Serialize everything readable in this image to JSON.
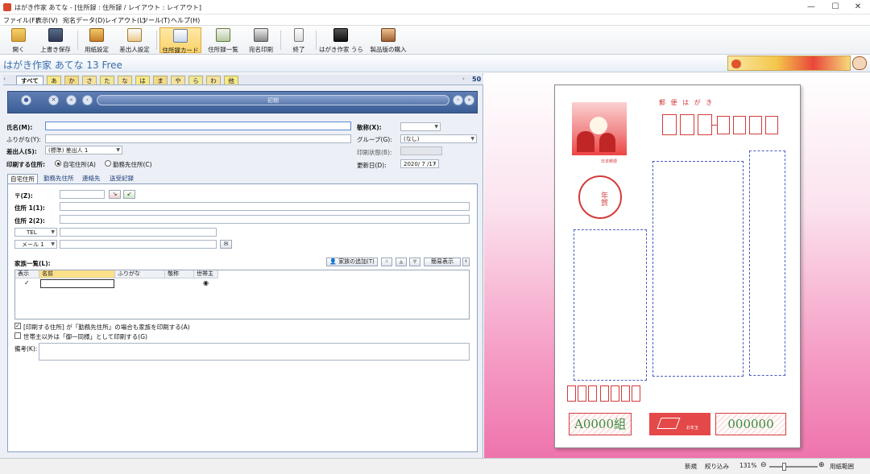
{
  "window": {
    "title": "はがき作家 あてな - [住所録 : 住所録 / レイアウト : レイアウト]",
    "minimize": "—",
    "maximize": "☐",
    "close": "✕"
  },
  "menu": [
    "ファイル(F)",
    "表示(V)",
    "宛名データ(D)",
    "レイアウト(L)",
    "ツール(T)",
    "ヘルプ(H)"
  ],
  "toolbar": {
    "items": [
      {
        "label": "開く",
        "icon": "folder-open-icon"
      },
      {
        "label": "上書き保存",
        "icon": "save-icon"
      },
      {
        "label": "用紙設定",
        "icon": "paper-settings-icon"
      },
      {
        "label": "差出人設定",
        "icon": "sender-settings-icon"
      },
      {
        "label": "住所録カード",
        "icon": "address-card-icon"
      },
      {
        "label": "住所録一覧",
        "icon": "address-list-icon"
      },
      {
        "label": "宛名印刷",
        "icon": "printer-icon"
      },
      {
        "label": "終了",
        "icon": "exit-icon"
      },
      {
        "label": "はがき作家 うら",
        "icon": "hagaki-ura-icon"
      },
      {
        "label": "製品版の購入",
        "icon": "cart-icon"
      }
    ],
    "active_index": 4
  },
  "app_title": "はがき作家 あてな 13 Free",
  "index_tabs": [
    "すべて",
    "あ",
    "か",
    "さ",
    "た",
    "な",
    "は",
    "ま",
    "や",
    "ら",
    "わ",
    "他"
  ],
  "record_count": "50",
  "nav": {
    "slider_label": "初期"
  },
  "form": {
    "name_label": "氏名(M):",
    "furigana_label": "ふりがな(Y):",
    "sender_label": "差出人(S):",
    "sender_value": "(標準) 差出人 1",
    "print_address_label": "印刷する住所:",
    "radio_home": "自宅住所(A)",
    "radio_work": "勤務先住所(C)",
    "honorific_label": "敬称(X):",
    "group_label": "グループ(G):",
    "group_value": "(なし)",
    "print_status_label": "印刷状態(B):",
    "updated_label": "更新日(D):",
    "updated_value": "2020/ 7 /17"
  },
  "subtabs": [
    "自宅住所",
    "勤務先住所",
    "連絡先",
    "送受記録"
  ],
  "address": {
    "zip_label": "〒(Z):",
    "addr1_label": "住所 1(1):",
    "addr2_label": "住所 2(2):",
    "tel_label": "TEL",
    "mail_label": "メール 1"
  },
  "family": {
    "label": "家族一覧(L):",
    "add_button": "家族の追加(T)",
    "simple_view": "簡易表示",
    "columns": [
      "表示",
      "名前",
      "ふりがな",
      "敬称",
      "世帯主"
    ],
    "rows": [
      {
        "show": "✓",
        "householder": "◉"
      }
    ]
  },
  "options": {
    "check1": "[印刷する住所] が「勤務先住所」の場合も家族を印刷する(A)",
    "check2": "世帯主以外は「御一同様」として印刷する(G)",
    "notes_label": "備考(K):"
  },
  "status": {
    "new": "新規",
    "filter": "絞り込み",
    "zoom": "131%",
    "paper_range": "用紙範囲"
  },
  "postcard": {
    "header": "郵 便 は が き",
    "stamp_caption": "日本郵便",
    "nenga": "年賀",
    "lot_left": "A0000組",
    "lot_right": "000000",
    "lot_center": "お年玉"
  },
  "colors": {
    "accent": "#3a6ea8",
    "postcard_red": "#d43b3b",
    "lot_green": "#3b8a3b",
    "preview_pink": "#ee74ad"
  }
}
